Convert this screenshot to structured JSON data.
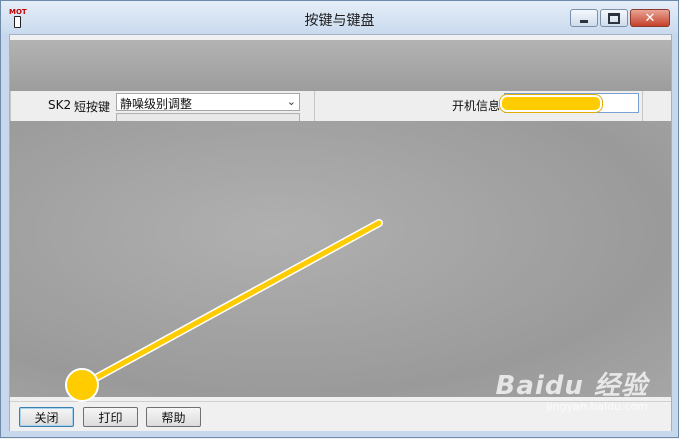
{
  "window": {
    "title": "按键与键盘",
    "icon_tag": "MOT",
    "controls": {
      "minimize": "minimize-icon",
      "maximize": "maximize-icon",
      "close": "close-icon"
    }
  },
  "key_row": {
    "key_label": "SK2",
    "press_label": "短按键",
    "function_value": "静噪级别调整"
  },
  "boot": {
    "label": "开机信息",
    "value": ""
  },
  "buttons": {
    "close": "关闭",
    "print": "打印",
    "help": "帮助"
  },
  "watermark": {
    "logo": "Baidu 经验",
    "site": "jingyan.baidu.com"
  },
  "colors": {
    "highlight": "#ffcc00",
    "titlebar": "#c9daee",
    "close_button": "#c4412b"
  }
}
